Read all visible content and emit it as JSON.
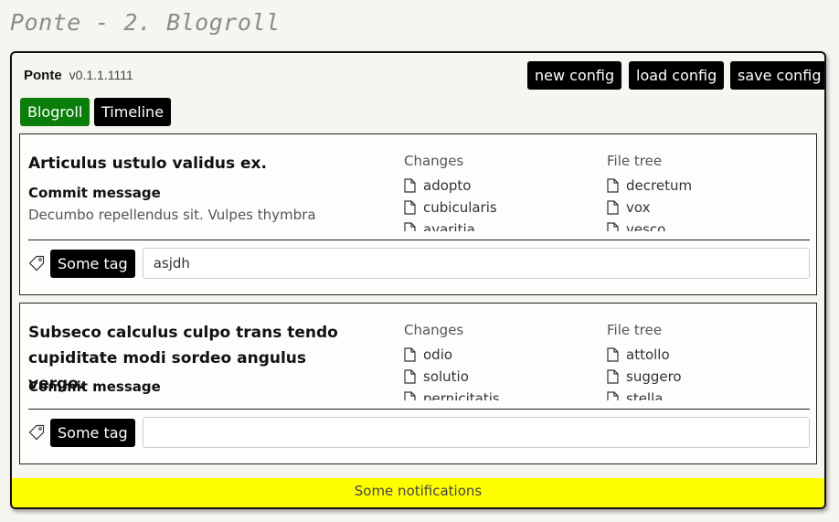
{
  "page_title": "Ponte - 2. Blogroll",
  "header": {
    "app_name": "Ponte",
    "version": "v0.1.1.1111"
  },
  "toolbar": {
    "new_config": "new config",
    "load_config": "load config",
    "save_config": "save config"
  },
  "tabs": [
    {
      "label": "Blogroll",
      "active": true
    },
    {
      "label": "Timeline",
      "active": false
    }
  ],
  "posts": [
    {
      "title": "Articulus ustulo validus ex.",
      "commit_label": "Commit message",
      "commit_text": "Decumbo repellendus sit. Vulpes thymbra",
      "changes_label": "Changes",
      "changes": [
        "adopto",
        "cubicularis",
        "avaritia"
      ],
      "filetree_label": "File tree",
      "files": [
        "decretum",
        "vox",
        "vesco"
      ],
      "tag_label": "Some tag",
      "tag_value": "asjdh"
    },
    {
      "title": "Subseco calculus culpo trans tendo cupiditate modi sordeo angulus vergo.",
      "commit_label": "Commit message",
      "commit_text": "",
      "changes_label": "Changes",
      "changes": [
        "odio",
        "solutio",
        "pernicitatis"
      ],
      "filetree_label": "File tree",
      "files": [
        "attollo",
        "suggero",
        "stella"
      ],
      "tag_label": "Some tag",
      "tag_value": ""
    }
  ],
  "notifications": "Some notifications",
  "colors": {
    "active_tab": "#0b7d0b",
    "notification_bg": "#ffff00",
    "button_bg": "#000000"
  }
}
